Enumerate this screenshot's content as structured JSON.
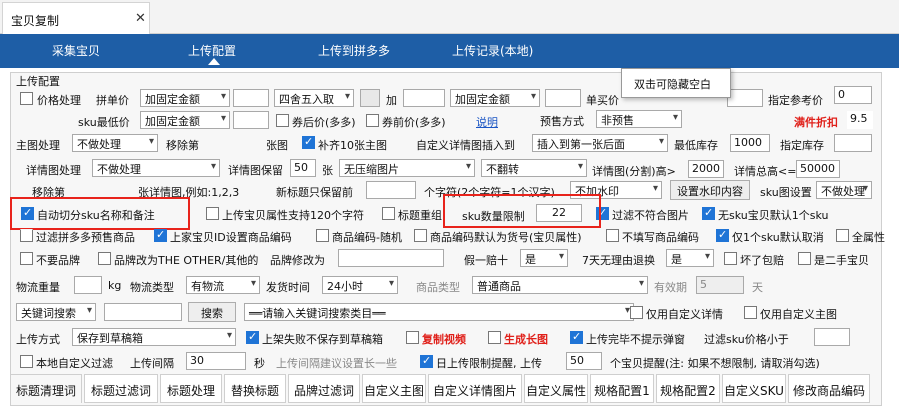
{
  "window": {
    "tab_title": "宝贝复制"
  },
  "nav": {
    "items": [
      "采集宝贝",
      "上传配置",
      "上传到拼多多",
      "上传记录(本地)"
    ]
  },
  "tooltip": "双击可隐藏空白",
  "section_title": "上传配置",
  "row1": {
    "price_label": "价格处理",
    "price_checked": false,
    "batch_price_label": "拼单价",
    "fixed1": "加固定金额",
    "round": "四舍五入取",
    "add_label": "加",
    "fixed2": "加固定金额",
    "unit_price_label": "单买价",
    "ref_price_label": "指定参考价",
    "ref_price_value": "0"
  },
  "row2": {
    "sku_min_label": "sku最低价",
    "fixed3": "加固定金额",
    "coupon_after": "券后价(多多)",
    "coupon_before": "券前价(多多)",
    "explain_link": "说明",
    "presale_label": "预售方式",
    "presale_value": "非预售",
    "discount_label": "满件折扣",
    "discount_value": "9.5"
  },
  "row3": {
    "main_img_label": "主图处理",
    "main_img_value": "不做处理",
    "remove_label": "移除第",
    "img_suffix": "张图",
    "fill10_label": "补齐10张主图",
    "fill10_checked": true,
    "custom_detail_label": "自定义详情图插入到",
    "insert_value": "插入到第一张后面",
    "min_stock_label": "最低库存",
    "min_stock_value": "1000",
    "stock_label": "指定库存"
  },
  "row4": {
    "detail_img_label": "详情图处理",
    "detail_img_value": "不做处理",
    "keep_label": "详情图保留",
    "keep_value": "50",
    "zhang": "张",
    "compress_value": "无压缩图片",
    "flip_value": "不翻转",
    "split_label": "详情图(分割)高>",
    "split_value": "2000",
    "total_label": "详情总高<=",
    "total_value": "50000"
  },
  "row5": {
    "remove_label": "移除第",
    "detail_example": "张详情图,例如:1,2,3",
    "new_title_label": "新标题只保留前",
    "chars_label": "个字符(2个字符=1个汉字)",
    "watermark_value": "不加水印",
    "watermark_btn": "设置水印内容",
    "sku_img_label": "sku图设置",
    "sku_img_value": "不做处理"
  },
  "row6": {
    "auto_split": "自动切分sku名称和备注",
    "auto_split_checked": true,
    "upload_attr": "上传宝贝属性支持120个字符",
    "title_recheck": "标题重组",
    "sku_limit_label": "sku数量限制",
    "sku_limit_value": "22",
    "filter_img": "过滤不符合图片",
    "filter_img_checked": true,
    "no_sku": "无sku宝贝默认1个sku",
    "no_sku_checked": true
  },
  "row7": {
    "filter_pdd": "过滤拼多多预售商品",
    "filter_pdd_checked": false,
    "set_code": "上家宝贝ID设置商品编码",
    "set_code_checked": true,
    "random_code": "商品编码-随机",
    "code_default": "商品编码默认为货号(宝贝属性)",
    "no_code": "不填写商品编码",
    "one_sku": "仅1个sku默认取消",
    "one_sku_checked": true,
    "all_attr": "全属性"
  },
  "row8": {
    "no_brand": "不要品牌",
    "brand_other": "品牌改为THE OTHER/其他的",
    "brand_change": "品牌修改为",
    "fake_label": "假一赔十",
    "fake_value": "是",
    "seven_day": "7天无理由退换",
    "seven_value": "是",
    "broken": "坏了包赔",
    "second_hand": "是二手宝贝"
  },
  "row9": {
    "weight_label": "物流重量",
    "kg": "kg",
    "logistics_label": "物流类型",
    "logistics_value": "有物流",
    "ship_label": "发货时间",
    "ship_value": "24小时",
    "goods_type_label": "商品类型",
    "goods_type_value": "普通商品",
    "valid_label": "有效期",
    "valid_value": "5",
    "days": "天"
  },
  "row10": {
    "keyword_value": "关键词搜索",
    "search_btn": "搜索",
    "category_value": "══请输入关键词搜索类目══",
    "custom_detail": "仅用自定义详情",
    "custom_main": "仅用自定义主图"
  },
  "row11": {
    "upload_mode_label": "上传方式",
    "upload_mode_value": "保存到草稿箱",
    "fail_save": "上架失败不保存到草稿箱",
    "fail_save_checked": true,
    "copy_video": "复制视频",
    "copy_video_checked": false,
    "gen_img": "生成长图",
    "gen_img_checked": false,
    "no_popup": "上传完毕不提示弹窗",
    "no_popup_checked": true,
    "filter_sku_price": "过滤sku价格小于"
  },
  "row12": {
    "local_filter": "本地自定义过滤",
    "interval_label": "上传间隔",
    "interval_value": "30",
    "seconds": "秒",
    "interval_hint": "上传间隔建议设置长一些",
    "daily_limit": "日上传限制提醒, 上传",
    "daily_checked": true,
    "daily_value": "50",
    "daily_hint": "个宝贝提醒(注: 如果不想限制, 请取消勾选)"
  },
  "bottom_tabs": [
    "标题清理词",
    "标题过滤词",
    "标题处理",
    "替换标题",
    "品牌过滤词",
    "自定义主图",
    "自定义详情图片",
    "自定义属性",
    "规格配置1",
    "规格配置2",
    "自定义SKU",
    "修改商品编码"
  ],
  "colors": {
    "nav_bg": "#1e5ea6",
    "highlight": "#e8231b",
    "checkbox": "#1f74d6",
    "link": "#1a55c4"
  }
}
